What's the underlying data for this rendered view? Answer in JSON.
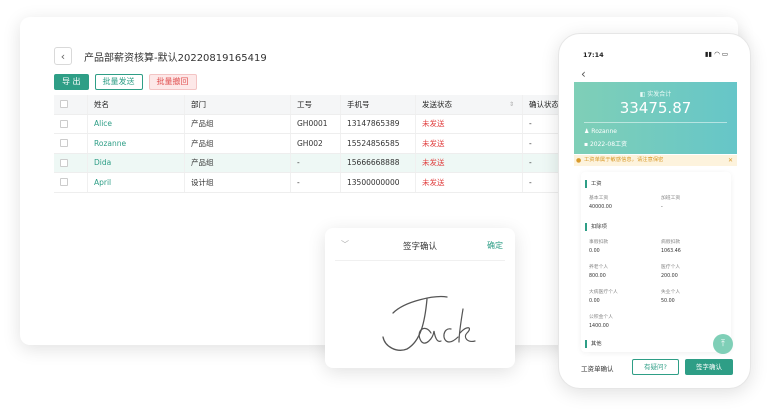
{
  "desktop": {
    "back_icon": "chevron-left-icon",
    "title": "产品部薪资核算-默认20220819165419",
    "actions": {
      "export": "导 出",
      "batch_send": "批量发送",
      "batch_revoke": "批量撤回"
    },
    "columns": [
      "姓名",
      "部门",
      "工号",
      "手机号",
      "发送状态",
      "确认状态"
    ],
    "rows": [
      {
        "name": "Alice",
        "dept": "产品组",
        "id": "GH0001",
        "phone": "13147865389",
        "send": "未发送",
        "confirm": "-"
      },
      {
        "name": "Rozanne",
        "dept": "产品组",
        "id": "GH002",
        "phone": "15524856585",
        "send": "未发送",
        "confirm": "-"
      },
      {
        "name": "Dida",
        "dept": "产品组",
        "id": "-",
        "phone": "15666668888",
        "send": "未发送",
        "confirm": "-"
      },
      {
        "name": "April",
        "dept": "设计组",
        "id": "-",
        "phone": "13500000000",
        "send": "未发送",
        "confirm": "-"
      }
    ]
  },
  "signature": {
    "title": "签字确认",
    "confirm": "确定",
    "signed_name": "Jack"
  },
  "phone": {
    "time": "17:14",
    "banner": {
      "label": "实发合计",
      "amount": "33475.87",
      "user": "Rozanne",
      "period": "2022-08工资"
    },
    "notice": "工资单属于敏感信息，请注意保密",
    "sections": {
      "salary": "工资",
      "deduct": "扣除项",
      "other": "其他"
    },
    "fields": {
      "base_label": "基本工资",
      "base_value": "40000.00",
      "ot_label": "加班工资",
      "ot_value": "-",
      "leave_label": "事假扣款",
      "leave_value": "0.00",
      "sick_label": "病假扣款",
      "sick_value": "1063.46",
      "pension_label": "养老个人",
      "pension_value": "800.00",
      "medical_label": "医疗个人",
      "medical_value": "200.00",
      "major_label": "大病医疗个人",
      "major_value": "0.00",
      "unemp_label": "失业个人",
      "unemp_value": "50.00",
      "fund_label": "公积金个人",
      "fund_value": "1400.00"
    },
    "footer": {
      "label": "工资单确认",
      "question": "有疑问?",
      "sign": "签字确认"
    },
    "colors": {
      "accent": "#2e9e86",
      "banner_start": "#7fcfb7",
      "banner_end": "#66c6c8"
    }
  }
}
